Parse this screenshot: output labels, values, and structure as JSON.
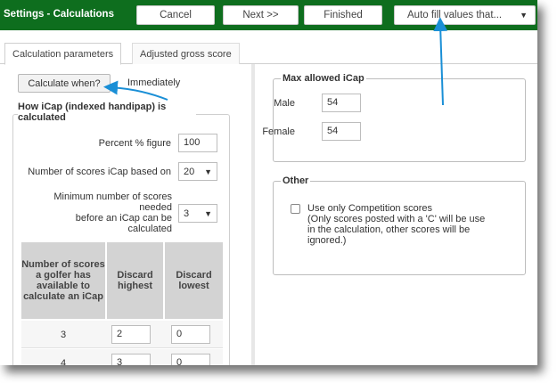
{
  "titlebar": {
    "title": "Settings - Calculations",
    "cancel_label": "Cancel",
    "next_label": "Next >>",
    "finished_label": "Finished",
    "autofill_label": "Auto fill values that...",
    "autofill_caret": "▼"
  },
  "tabs": [
    {
      "label": "Calculation parameters",
      "active": true
    },
    {
      "label": "Adjusted gross score",
      "active": false
    }
  ],
  "calc": {
    "button_label": "Calculate when?",
    "value": "Immediately"
  },
  "icap_section": {
    "title": "How iCap (indexed handipap) is calculated",
    "percent_label": "Percent % figure",
    "percent_value": "100",
    "num_scores_label": "Number of scores iCap based on",
    "num_scores_value": "20",
    "min_scores_label_1": "Minimum number of scores",
    "min_scores_label_2": "needed",
    "min_scores_label_3": "before an iCap can be",
    "min_scores_label_4": "calculated",
    "min_scores_value": "3",
    "caret": "▼"
  },
  "table": {
    "headers": [
      "Number of scores a golfer has available to calculate an iCap",
      "Discard highest",
      "Discard lowest"
    ],
    "rows": [
      {
        "scores": "3",
        "discard_highest": "2",
        "discard_lowest": "0"
      },
      {
        "scores": "4",
        "discard_highest": "3",
        "discard_lowest": "0"
      }
    ]
  },
  "max_icap": {
    "legend": "Max allowed iCap",
    "male_label": "Male",
    "male_value": "54",
    "female_label": "Female",
    "female_value": "54"
  },
  "other": {
    "legend": "Other",
    "checkbox_label": "Use only Competition scores",
    "checked": false,
    "note_1": "(Only scores posted with a 'C' will be use",
    "note_2": "in the calculation, other scores will be",
    "note_3": "ignored.)"
  },
  "colors": {
    "titlebar": "#0e6e1e",
    "annotation_arrow": "#1a8fd6"
  }
}
